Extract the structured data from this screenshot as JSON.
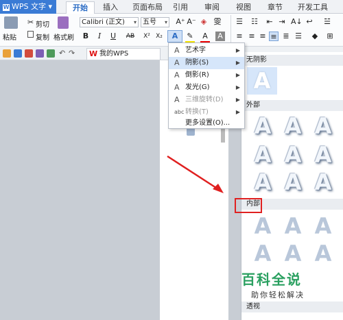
{
  "app": {
    "name": "WPS 文字"
  },
  "tabs": [
    "开始",
    "插入",
    "页面布局",
    "引用",
    "审阅",
    "视图",
    "章节",
    "开发工具"
  ],
  "active_tab": "开始",
  "clipboard": {
    "paste": "粘贴",
    "cut": "剪切",
    "copy": "复制",
    "format_painter": "格式刷"
  },
  "font": {
    "family": "Calibri (正文)",
    "size": "五号"
  },
  "format_buttons": {
    "bold": "B",
    "italic": "I",
    "underline": "U",
    "strike": "AB",
    "superscript": "X²",
    "subscript": "X₂"
  },
  "doc_tab": {
    "name": "我的WPS"
  },
  "menu": {
    "items": [
      {
        "label": "艺术字",
        "icon": "A",
        "submenu": true,
        "disabled": false
      },
      {
        "label": "阴影(S)",
        "icon": "A",
        "submenu": true,
        "disabled": false,
        "highlighted": true
      },
      {
        "label": "倒影(R)",
        "icon": "A",
        "submenu": true,
        "disabled": false
      },
      {
        "label": "发光(G)",
        "icon": "A",
        "submenu": true,
        "disabled": false
      },
      {
        "label": "三维旋转(D)",
        "icon": "A",
        "submenu": true,
        "disabled": true
      },
      {
        "label": "转换(T)",
        "icon": "abc",
        "submenu": true,
        "disabled": true
      },
      {
        "label": "更多设置(O)...",
        "icon": "",
        "submenu": false,
        "disabled": false
      }
    ]
  },
  "gallery": {
    "sections": [
      {
        "title": "无阴影"
      },
      {
        "title": "外部"
      },
      {
        "title": "内部"
      },
      {
        "title": "透视"
      }
    ],
    "glyph": "A"
  },
  "watermark": {
    "title": "百科全说",
    "subtitle": "助你轻松解决"
  },
  "colors": {
    "accent": "#3a7bd5",
    "highlight": "#e02020",
    "watermark": "#2aa060"
  }
}
